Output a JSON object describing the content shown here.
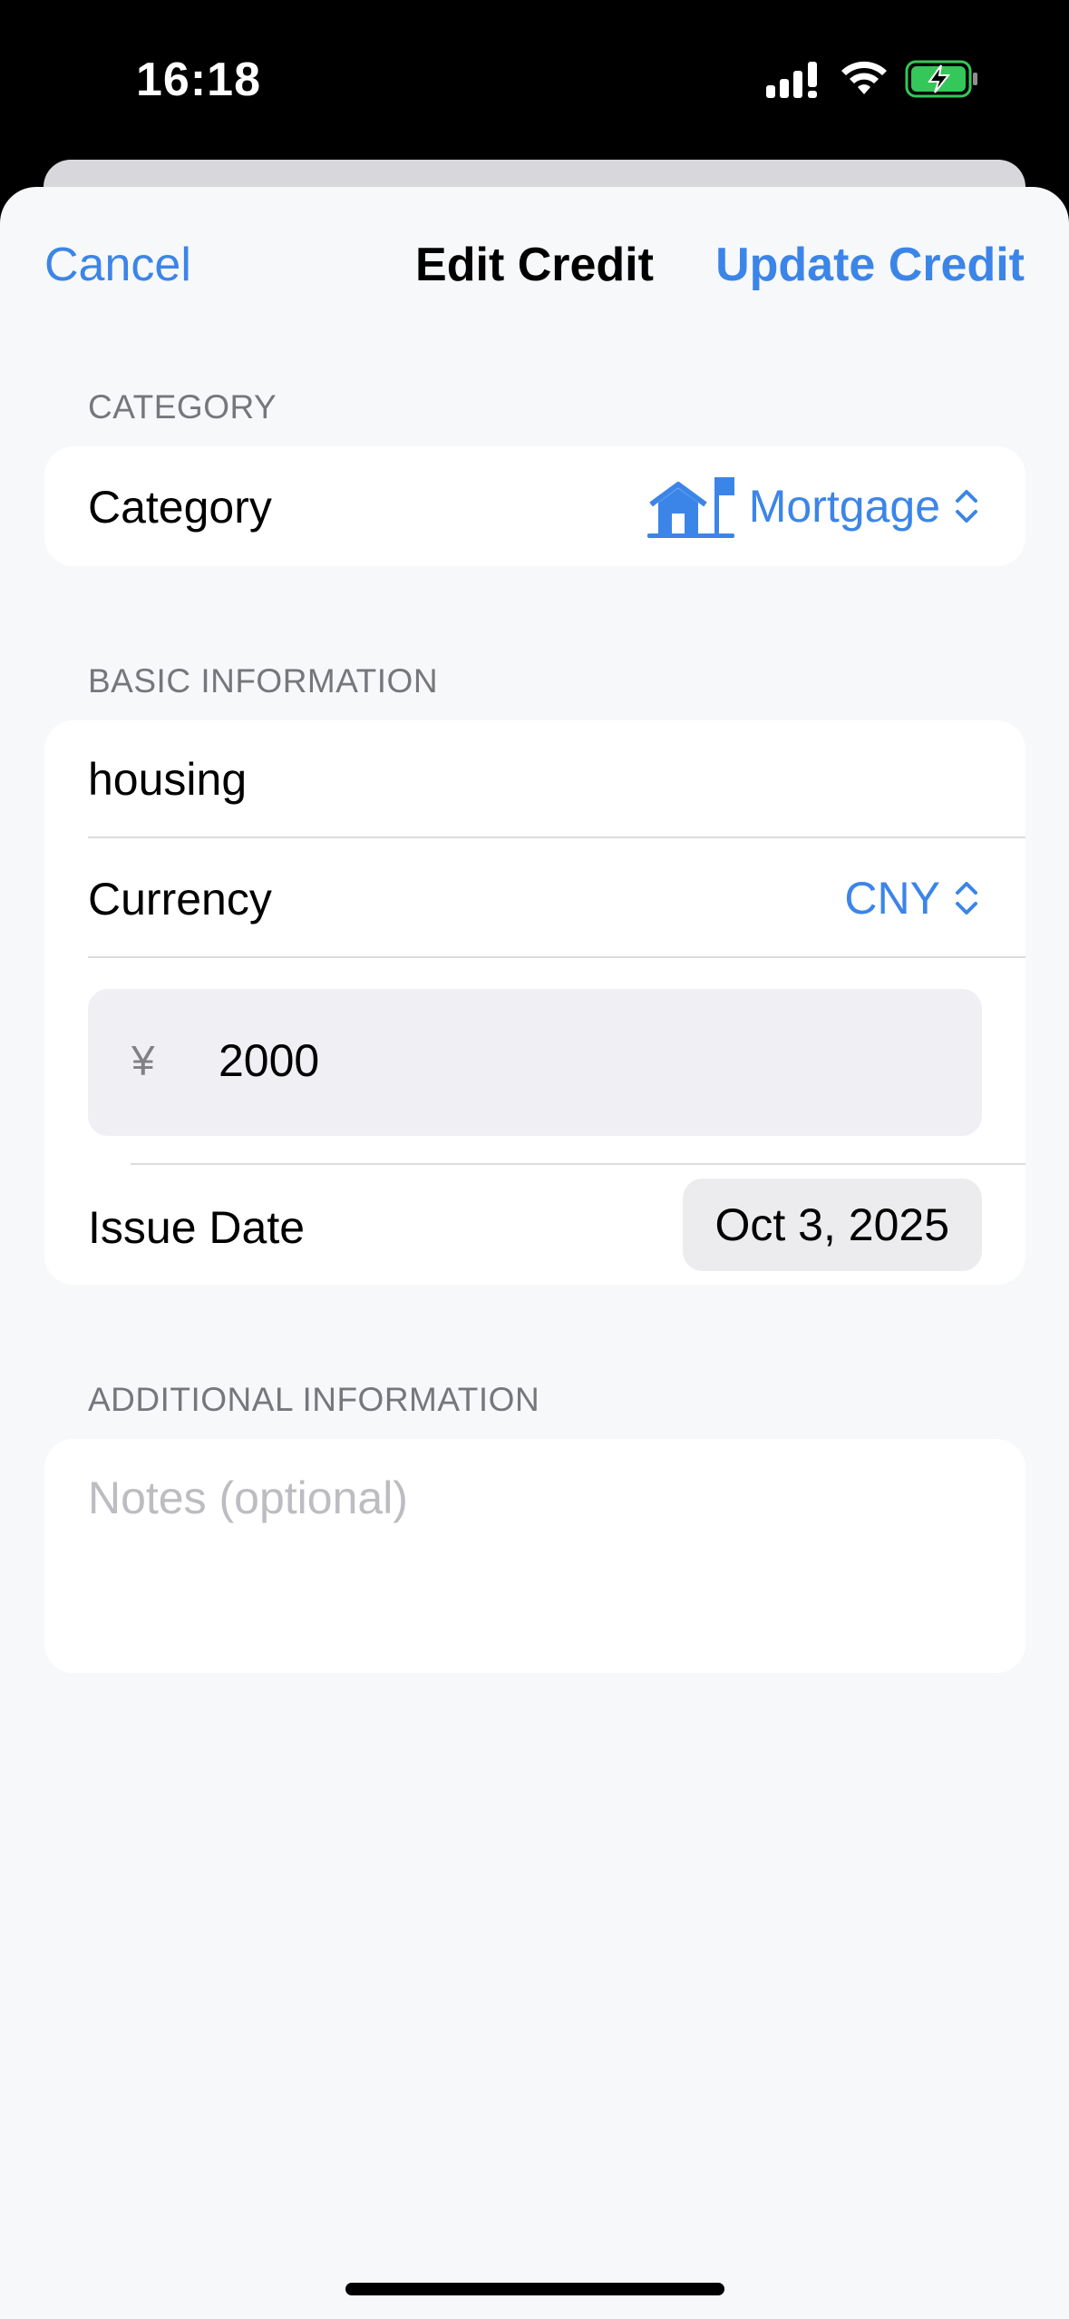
{
  "status_bar": {
    "time": "16:18"
  },
  "nav": {
    "cancel_label": "Cancel",
    "title": "Edit Credit",
    "update_label": "Update Credit"
  },
  "category_section": {
    "header": "CATEGORY",
    "row_label": "Category",
    "selected_value": "Mortgage",
    "icon": "house-with-flag-icon"
  },
  "basic_section": {
    "header": "BASIC INFORMATION",
    "name_value": "housing",
    "currency_label": "Currency",
    "currency_value": "CNY",
    "currency_symbol": "¥",
    "amount_value": "2000",
    "issue_date_label": "Issue Date",
    "issue_date_value": "Oct 3, 2025"
  },
  "additional_section": {
    "header": "ADDITIONAL INFORMATION",
    "notes_placeholder": "Notes (optional)"
  },
  "colors": {
    "accent": "#3c85e8",
    "background": "#f7f8fa",
    "battery_green": "#34c759"
  }
}
